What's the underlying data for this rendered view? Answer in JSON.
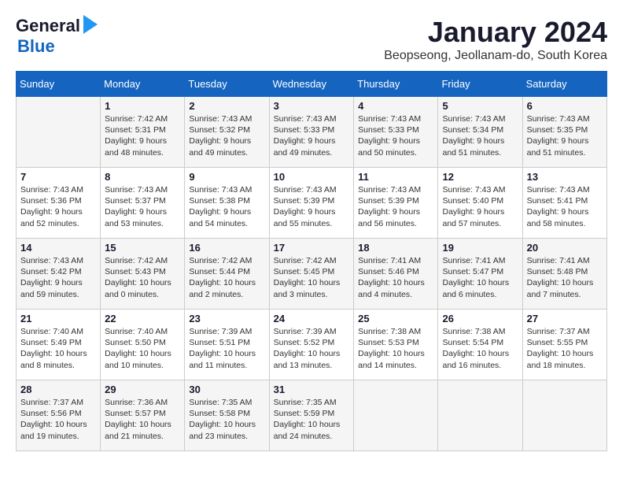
{
  "logo": {
    "line1": "General",
    "line2": "Blue"
  },
  "title": "January 2024",
  "location": "Beopseong, Jeollanam-do, South Korea",
  "days_of_week": [
    "Sunday",
    "Monday",
    "Tuesday",
    "Wednesday",
    "Thursday",
    "Friday",
    "Saturday"
  ],
  "weeks": [
    [
      {
        "day": "",
        "sunrise": "",
        "sunset": "",
        "daylight": ""
      },
      {
        "day": "1",
        "sunrise": "Sunrise: 7:42 AM",
        "sunset": "Sunset: 5:31 PM",
        "daylight": "Daylight: 9 hours and 48 minutes."
      },
      {
        "day": "2",
        "sunrise": "Sunrise: 7:43 AM",
        "sunset": "Sunset: 5:32 PM",
        "daylight": "Daylight: 9 hours and 49 minutes."
      },
      {
        "day": "3",
        "sunrise": "Sunrise: 7:43 AM",
        "sunset": "Sunset: 5:33 PM",
        "daylight": "Daylight: 9 hours and 49 minutes."
      },
      {
        "day": "4",
        "sunrise": "Sunrise: 7:43 AM",
        "sunset": "Sunset: 5:33 PM",
        "daylight": "Daylight: 9 hours and 50 minutes."
      },
      {
        "day": "5",
        "sunrise": "Sunrise: 7:43 AM",
        "sunset": "Sunset: 5:34 PM",
        "daylight": "Daylight: 9 hours and 51 minutes."
      },
      {
        "day": "6",
        "sunrise": "Sunrise: 7:43 AM",
        "sunset": "Sunset: 5:35 PM",
        "daylight": "Daylight: 9 hours and 51 minutes."
      }
    ],
    [
      {
        "day": "7",
        "sunrise": "Sunrise: 7:43 AM",
        "sunset": "Sunset: 5:36 PM",
        "daylight": "Daylight: 9 hours and 52 minutes."
      },
      {
        "day": "8",
        "sunrise": "Sunrise: 7:43 AM",
        "sunset": "Sunset: 5:37 PM",
        "daylight": "Daylight: 9 hours and 53 minutes."
      },
      {
        "day": "9",
        "sunrise": "Sunrise: 7:43 AM",
        "sunset": "Sunset: 5:38 PM",
        "daylight": "Daylight: 9 hours and 54 minutes."
      },
      {
        "day": "10",
        "sunrise": "Sunrise: 7:43 AM",
        "sunset": "Sunset: 5:39 PM",
        "daylight": "Daylight: 9 hours and 55 minutes."
      },
      {
        "day": "11",
        "sunrise": "Sunrise: 7:43 AM",
        "sunset": "Sunset: 5:39 PM",
        "daylight": "Daylight: 9 hours and 56 minutes."
      },
      {
        "day": "12",
        "sunrise": "Sunrise: 7:43 AM",
        "sunset": "Sunset: 5:40 PM",
        "daylight": "Daylight: 9 hours and 57 minutes."
      },
      {
        "day": "13",
        "sunrise": "Sunrise: 7:43 AM",
        "sunset": "Sunset: 5:41 PM",
        "daylight": "Daylight: 9 hours and 58 minutes."
      }
    ],
    [
      {
        "day": "14",
        "sunrise": "Sunrise: 7:43 AM",
        "sunset": "Sunset: 5:42 PM",
        "daylight": "Daylight: 9 hours and 59 minutes."
      },
      {
        "day": "15",
        "sunrise": "Sunrise: 7:42 AM",
        "sunset": "Sunset: 5:43 PM",
        "daylight": "Daylight: 10 hours and 0 minutes."
      },
      {
        "day": "16",
        "sunrise": "Sunrise: 7:42 AM",
        "sunset": "Sunset: 5:44 PM",
        "daylight": "Daylight: 10 hours and 2 minutes."
      },
      {
        "day": "17",
        "sunrise": "Sunrise: 7:42 AM",
        "sunset": "Sunset: 5:45 PM",
        "daylight": "Daylight: 10 hours and 3 minutes."
      },
      {
        "day": "18",
        "sunrise": "Sunrise: 7:41 AM",
        "sunset": "Sunset: 5:46 PM",
        "daylight": "Daylight: 10 hours and 4 minutes."
      },
      {
        "day": "19",
        "sunrise": "Sunrise: 7:41 AM",
        "sunset": "Sunset: 5:47 PM",
        "daylight": "Daylight: 10 hours and 6 minutes."
      },
      {
        "day": "20",
        "sunrise": "Sunrise: 7:41 AM",
        "sunset": "Sunset: 5:48 PM",
        "daylight": "Daylight: 10 hours and 7 minutes."
      }
    ],
    [
      {
        "day": "21",
        "sunrise": "Sunrise: 7:40 AM",
        "sunset": "Sunset: 5:49 PM",
        "daylight": "Daylight: 10 hours and 8 minutes."
      },
      {
        "day": "22",
        "sunrise": "Sunrise: 7:40 AM",
        "sunset": "Sunset: 5:50 PM",
        "daylight": "Daylight: 10 hours and 10 minutes."
      },
      {
        "day": "23",
        "sunrise": "Sunrise: 7:39 AM",
        "sunset": "Sunset: 5:51 PM",
        "daylight": "Daylight: 10 hours and 11 minutes."
      },
      {
        "day": "24",
        "sunrise": "Sunrise: 7:39 AM",
        "sunset": "Sunset: 5:52 PM",
        "daylight": "Daylight: 10 hours and 13 minutes."
      },
      {
        "day": "25",
        "sunrise": "Sunrise: 7:38 AM",
        "sunset": "Sunset: 5:53 PM",
        "daylight": "Daylight: 10 hours and 14 minutes."
      },
      {
        "day": "26",
        "sunrise": "Sunrise: 7:38 AM",
        "sunset": "Sunset: 5:54 PM",
        "daylight": "Daylight: 10 hours and 16 minutes."
      },
      {
        "day": "27",
        "sunrise": "Sunrise: 7:37 AM",
        "sunset": "Sunset: 5:55 PM",
        "daylight": "Daylight: 10 hours and 18 minutes."
      }
    ],
    [
      {
        "day": "28",
        "sunrise": "Sunrise: 7:37 AM",
        "sunset": "Sunset: 5:56 PM",
        "daylight": "Daylight: 10 hours and 19 minutes."
      },
      {
        "day": "29",
        "sunrise": "Sunrise: 7:36 AM",
        "sunset": "Sunset: 5:57 PM",
        "daylight": "Daylight: 10 hours and 21 minutes."
      },
      {
        "day": "30",
        "sunrise": "Sunrise: 7:35 AM",
        "sunset": "Sunset: 5:58 PM",
        "daylight": "Daylight: 10 hours and 23 minutes."
      },
      {
        "day": "31",
        "sunrise": "Sunrise: 7:35 AM",
        "sunset": "Sunset: 5:59 PM",
        "daylight": "Daylight: 10 hours and 24 minutes."
      },
      {
        "day": "",
        "sunrise": "",
        "sunset": "",
        "daylight": ""
      },
      {
        "day": "",
        "sunrise": "",
        "sunset": "",
        "daylight": ""
      },
      {
        "day": "",
        "sunrise": "",
        "sunset": "",
        "daylight": ""
      }
    ]
  ]
}
